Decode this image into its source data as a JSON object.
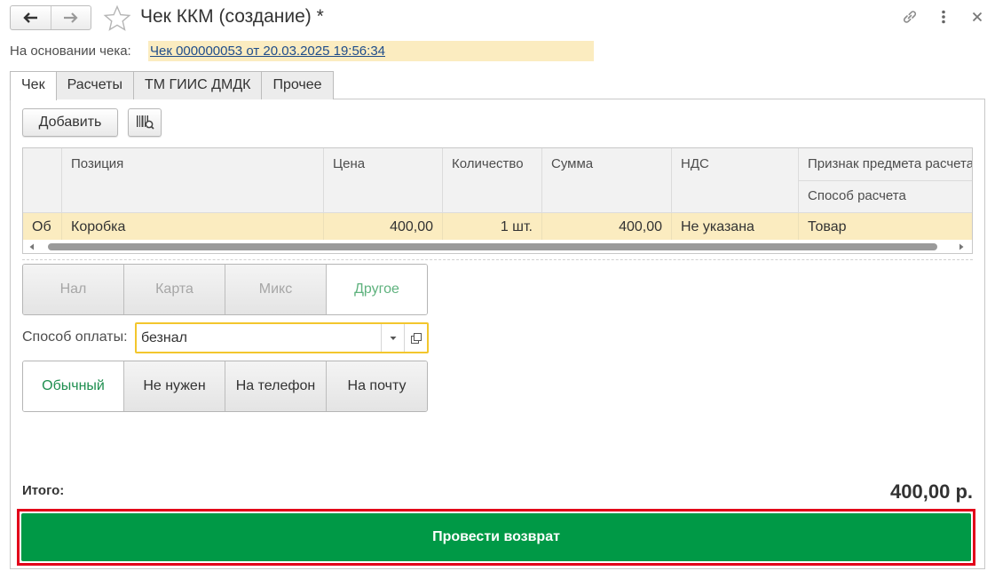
{
  "window": {
    "title": "Чек ККМ (создание) *",
    "icons": [
      "arrow-left-icon",
      "arrow-right-icon",
      "star-icon",
      "link-icon",
      "more-icon",
      "close-icon"
    ]
  },
  "basis": {
    "label": "На основании чека:",
    "link": "Чек 000000053 от 20.03.2025 19:56:34"
  },
  "tabs": [
    {
      "label": "Чек",
      "active": true
    },
    {
      "label": "Расчеты",
      "active": false
    },
    {
      "label": "ТМ ГИИС ДМДК",
      "active": false
    },
    {
      "label": "Прочее",
      "active": false
    }
  ],
  "toolbar": {
    "add_label": "Добавить",
    "barcode_icon": "barcode-search-icon"
  },
  "table": {
    "columns": [
      "Позиция",
      "Цена",
      "Количество",
      "Сумма",
      "НДС",
      "Признак предмета расчета"
    ],
    "subcolumn": "Способ расчета",
    "rows": [
      {
        "mark": "Об",
        "position": "Коробка",
        "price": "400,00",
        "qty": "1 шт.",
        "sum": "400,00",
        "vat": "Не указана",
        "subject": "Товар"
      }
    ]
  },
  "payment_types": {
    "items": [
      "Нал",
      "Карта",
      "Микс",
      "Другое"
    ],
    "selected": "Другое",
    "selected_color": "#5fb27e"
  },
  "payment_method": {
    "label": "Способ оплаты:",
    "value": "безнал"
  },
  "receipt_delivery": {
    "items": [
      "Обычный",
      "Не нужен",
      "На телефон",
      "На почту"
    ],
    "selected": "Обычный",
    "selected_color": "#1e8e4f"
  },
  "total": {
    "label": "Итого:",
    "value": "400,00 р."
  },
  "submit": {
    "label": "Провести возврат",
    "color": "#009946",
    "highlight_color": "#e2001a"
  }
}
